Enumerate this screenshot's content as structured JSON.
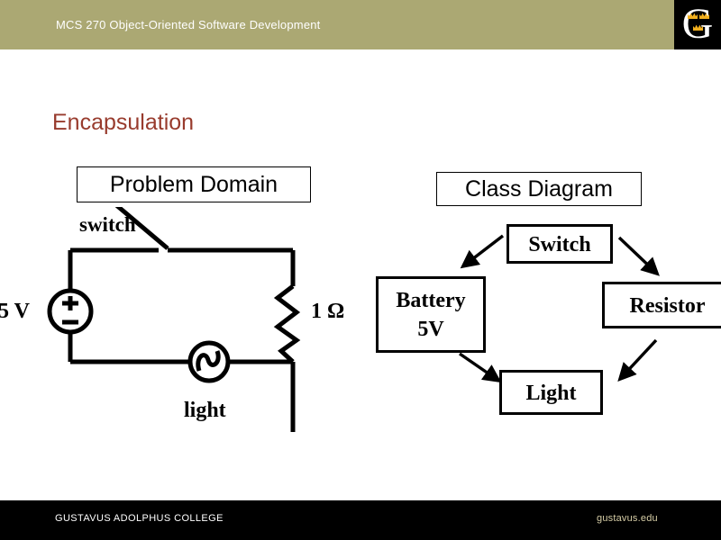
{
  "header": {
    "title": "MCS 270 Object-Oriented Software Development",
    "background_color": "#aba873",
    "logo": {
      "letter": "G",
      "name": "gustavus-logo",
      "background_color": "#000000",
      "crown_color": "#f2b01e"
    }
  },
  "slide": {
    "title": "Encapsulation",
    "title_color": "#983b2d",
    "sections": [
      {
        "label": "Problem Domain"
      },
      {
        "label": "Class Diagram"
      }
    ]
  },
  "circuit": {
    "labels": {
      "switch": "switch",
      "voltage": "5 V",
      "resistance": "1 Ω",
      "light": "light"
    },
    "components": [
      {
        "name": "voltage-source",
        "symbol": "circle-plus-minus",
        "value": "5 V"
      },
      {
        "name": "switch",
        "symbol": "open-switch",
        "value": "switch"
      },
      {
        "name": "resistor",
        "symbol": "zigzag",
        "value": "1 Ω"
      },
      {
        "name": "lamp",
        "symbol": "circle-filament",
        "value": "light"
      }
    ]
  },
  "class_diagram": {
    "classes": [
      {
        "name": "switch-class",
        "label": "Switch"
      },
      {
        "name": "battery-class",
        "label": "Battery\n5V",
        "line1": "Battery",
        "line2": "5V"
      },
      {
        "name": "resistor-class",
        "label": "Resistor"
      },
      {
        "name": "light-class",
        "label": "Light"
      }
    ],
    "associations": [
      {
        "from": "Switch",
        "to": "Battery"
      },
      {
        "from": "Switch",
        "to": "Resistor"
      },
      {
        "from": "Battery",
        "to": "Light"
      },
      {
        "from": "Resistor",
        "to": "Light"
      }
    ]
  },
  "footer": {
    "left_text": "GUSTAVUS ADOLPHUS COLLEGE",
    "right_text": "gustavus.edu",
    "background_color": "#000000",
    "right_text_color": "#d6cda6"
  }
}
